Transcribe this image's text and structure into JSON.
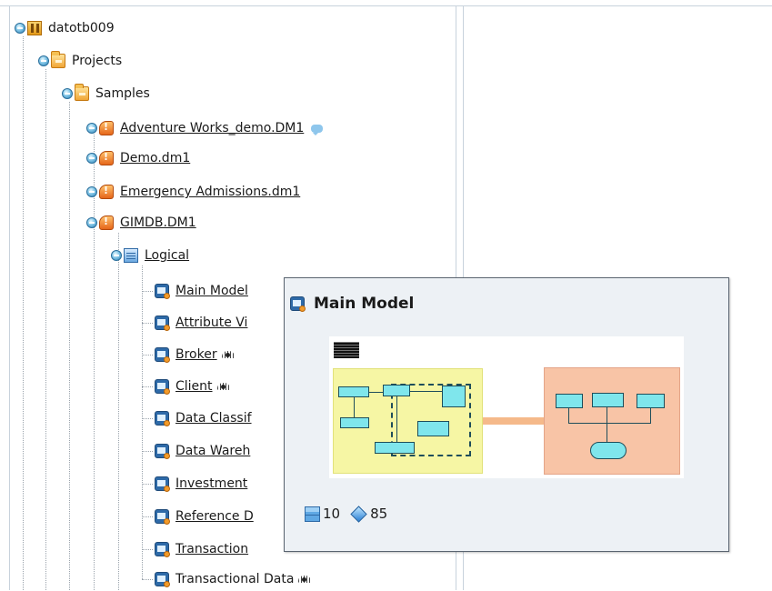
{
  "tree": {
    "server": {
      "label": "datotb009",
      "icon": "server-icon"
    },
    "projects": {
      "label": "Projects",
      "icon": "folder-icon"
    },
    "samples": {
      "label": "Samples",
      "icon": "folder-icon"
    },
    "models": [
      {
        "label": "Adventure Works_demo.DM1",
        "icon": "model-icon",
        "badge": "comment-icon"
      },
      {
        "label": "Demo.dm1",
        "icon": "model-icon"
      },
      {
        "label": "Emergency Admissions.dm1",
        "icon": "model-icon"
      },
      {
        "label": "GIMDB.DM1",
        "icon": "model-icon"
      }
    ],
    "logical": {
      "label": "Logical",
      "icon": "logical-model-icon"
    },
    "submodels": [
      {
        "label": "Main Model",
        "icon": "diagram-icon"
      },
      {
        "label": "Attribute Vi",
        "icon": "diagram-icon"
      },
      {
        "label": "Broker",
        "icon": "diagram-icon",
        "badge": "eye-icon"
      },
      {
        "label": "Client",
        "icon": "diagram-icon",
        "badge": "eye-icon"
      },
      {
        "label": "Data Classif",
        "icon": "diagram-icon"
      },
      {
        "label": "Data Wareh",
        "icon": "diagram-icon"
      },
      {
        "label": "Investment",
        "icon": "diagram-icon"
      },
      {
        "label": "Reference D",
        "icon": "diagram-icon"
      },
      {
        "label": "Transaction",
        "icon": "diagram-icon"
      },
      {
        "label": "Transactional Data",
        "icon": "diagram-icon",
        "badge": "eye-icon"
      }
    ]
  },
  "popup": {
    "title": "Main Model",
    "entity_count": "10",
    "attribute_count": "85",
    "colors": {
      "background": "#edf1f5",
      "border": "#5a6470",
      "entity_fill": "#7fe6ec",
      "area_yellow": "#f6f6a4",
      "area_orange": "#f8c4a6"
    }
  }
}
